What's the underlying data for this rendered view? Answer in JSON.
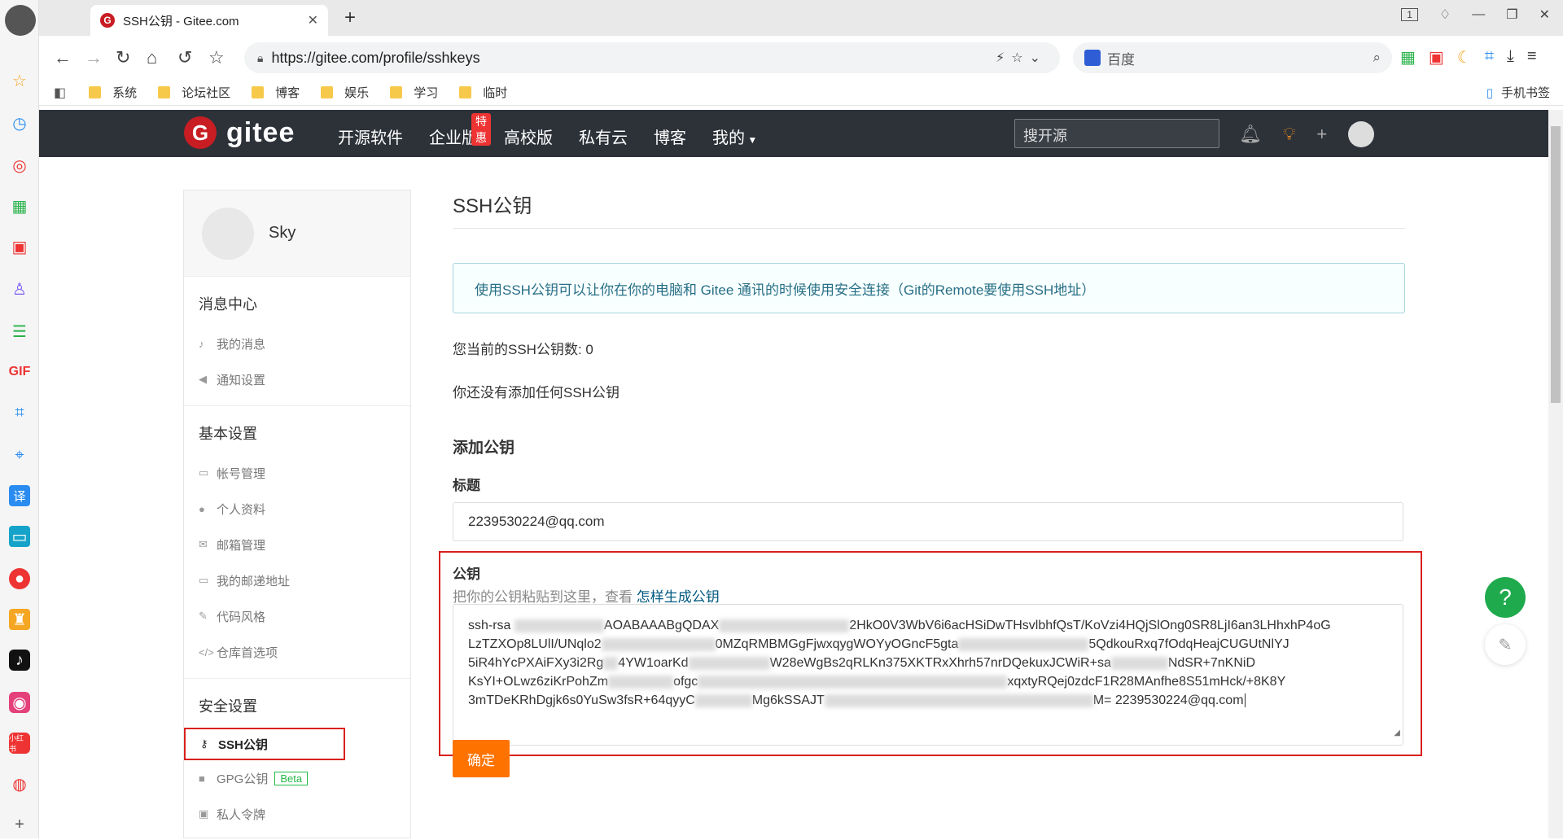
{
  "browser": {
    "tab_title": "SSH公钥 - Gitee.com",
    "tab_close": "✕",
    "new_tab": "+",
    "window_tab_count": "1",
    "url": "https://gitee.com/profile/sshkeys",
    "search_engine": "百度",
    "bookmarks": [
      "系统",
      "论坛社区",
      "博客",
      "娱乐",
      "学习",
      "临时"
    ],
    "mobile_bookmarks": "手机书签"
  },
  "gitee": {
    "logo_letter": "G",
    "logo_text": "gitee",
    "menu": [
      "开源软件",
      "企业版",
      "高校版",
      "私有云",
      "博客",
      "我的"
    ],
    "enterprise_badge": "特惠",
    "search_placeholder": "搜开源"
  },
  "sidebar": {
    "username": "Sky",
    "groups": [
      {
        "title": "消息中心",
        "items": [
          "我的消息",
          "通知设置"
        ]
      },
      {
        "title": "基本设置",
        "items": [
          "帐号管理",
          "个人资料",
          "邮箱管理",
          "我的邮递地址",
          "代码风格",
          "仓库首选项"
        ]
      },
      {
        "title": "安全设置",
        "items": [
          "SSH公钥",
          "GPG公钥",
          "私人令牌"
        ]
      }
    ],
    "beta": "Beta"
  },
  "main": {
    "title": "SSH公钥",
    "info": "使用SSH公钥可以让你在你的电脑和 Gitee 通讯的时候使用安全连接（Git的Remote要使用SSH地址）",
    "count_text": "您当前的SSH公钥数: 0",
    "empty_text": "你还没有添加任何SSH公钥",
    "add_heading": "添加公钥",
    "title_label": "标题",
    "title_value": "2239530224@qq.com",
    "key_label": "公钥",
    "key_hint": "把你的公钥粘贴到这里，查看",
    "key_hint_link": "怎样生成公钥",
    "key_line1_a": "ssh-rsa",
    "key_line1_b": "AOABAAABgQDAX",
    "key_line1_c": "2HkO0V3WbV6i6acHSiDwTHsvlbhfQsT/KoVzi4HQjSlOng0SR8LjI6an3LHhxhP4oG",
    "key_line2_a": "LzTZXOp8LUlI/UNqlo2",
    "key_line2_b": "0MZqRMBMGgFjwxqygWOYyOGncF5gta",
    "key_line2_c": "5QdkouRxq7fOdqHeajCUGUtNlYJ",
    "key_line3_a": "5iR4hYcPXAiFXy3i2Rg",
    "key_line3_b": "4YW1oarKd",
    "key_line3_c": "W28eWgBs2qRLKn375XKTRxXhrh57nrDQekuxJCWiR+sa",
    "key_line3_d": "NdSR+7nKNiD",
    "key_line4_a": "KsYI+OLwz6ziKrPohZm",
    "key_line4_b": "ofgc",
    "key_line4_c": "xqxtyRQej0zdcF1R28MAnfhe8S51mHck/+8K8Y",
    "key_line5_a": "3mTDeKRhDgjk6s0YuSw3fsR+64qyyC",
    "key_line5_b": "Mg6kSSAJT",
    "key_line5_c": "M= 2239530224@qq.com",
    "submit": "确定"
  },
  "colors": {
    "accent": "#fe7300",
    "brand": "#c71d23",
    "highlight_box": "#d9201d"
  }
}
